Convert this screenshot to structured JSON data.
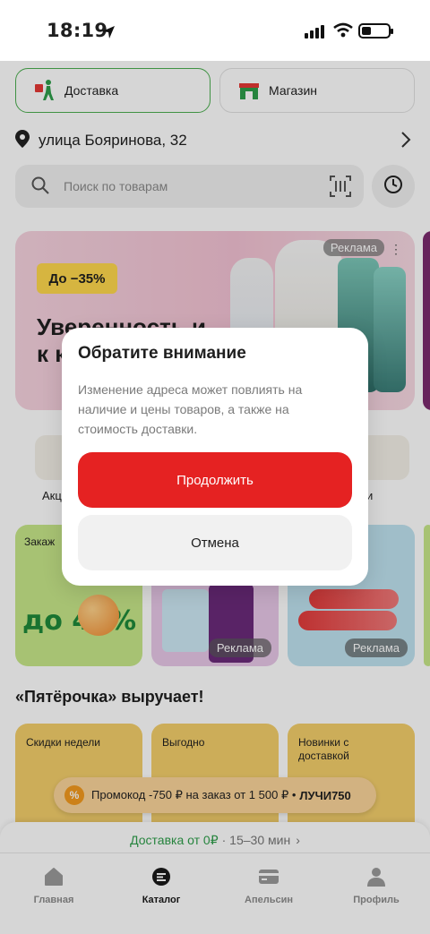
{
  "status_bar": {
    "time": "18:19"
  },
  "modes": {
    "delivery": "Доставка",
    "shop": "Магазин"
  },
  "address": {
    "text": "улица Бояринова, 32"
  },
  "search": {
    "placeholder": "Поиск по товарам"
  },
  "banner": {
    "badge": "До −35%",
    "headline": "Уверенность и к ка",
    "ad_label": "Реклама"
  },
  "categories": [
    {
      "label": "Акц"
    },
    {
      "label": "и"
    }
  ],
  "promos": [
    {
      "small": "Закаж",
      "big": "до 40%"
    },
    {
      "ad_label": "Реклама"
    },
    {
      "ad_label": "Реклама"
    }
  ],
  "section": {
    "title": "«Пятёрочка» выручает!"
  },
  "offers": [
    {
      "label": "Скидки недели"
    },
    {
      "label": "Выгодно"
    },
    {
      "label": "Новинки с доставкой"
    }
  ],
  "promo_pill": {
    "icon": "%",
    "text": "Промокод -750 ₽ на заказ от 1 500 ₽ •",
    "code": "ЛУЧИ750"
  },
  "delivery_bar": {
    "main": "Доставка от 0₽",
    "time": "· 15–30 мин",
    "arrow": "›"
  },
  "tabs": [
    {
      "label": "Главная",
      "icon": "home-icon"
    },
    {
      "label": "Каталог",
      "icon": "catalog-icon",
      "active": true
    },
    {
      "label": "Апельсин",
      "icon": "card-icon"
    },
    {
      "label": "Профиль",
      "icon": "profile-icon"
    }
  ],
  "modal": {
    "title": "Обратите внимание",
    "text": "Изменение адреса может повлиять на наличие и цены товаров, а также на стоимость доставки.",
    "continue_label": "Продолжить",
    "cancel_label": "Отмена"
  },
  "colors": {
    "accent_red": "#e52222",
    "accent_green": "#2e9e4a",
    "promo_pill": "#fbd49a"
  }
}
